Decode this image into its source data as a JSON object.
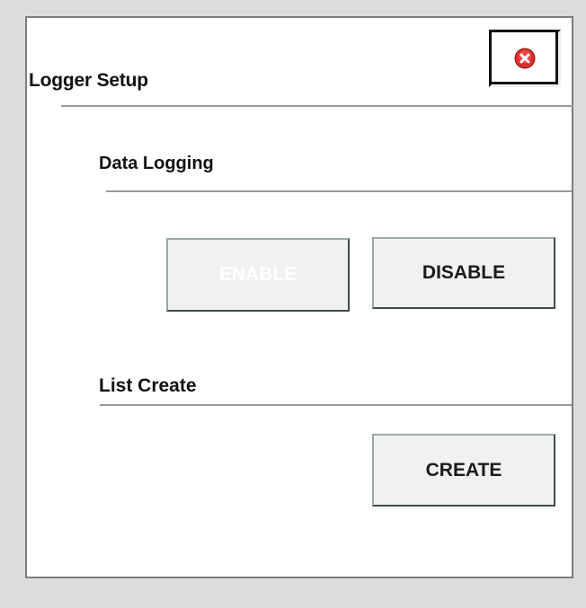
{
  "dialog": {
    "title": "Logger Setup",
    "close_icon": "close-icon"
  },
  "data_logging": {
    "label": "Data Logging",
    "enable_label": "ENABLE",
    "enable_state": "disabled",
    "disable_label": "DISABLE"
  },
  "list_create": {
    "label": "List Create",
    "create_label": "CREATE"
  },
  "colors": {
    "close_icon_red": "#d9302c",
    "background": "#dcdcdc",
    "panel": "#ffffff",
    "button_face": "#f1f1f1"
  }
}
